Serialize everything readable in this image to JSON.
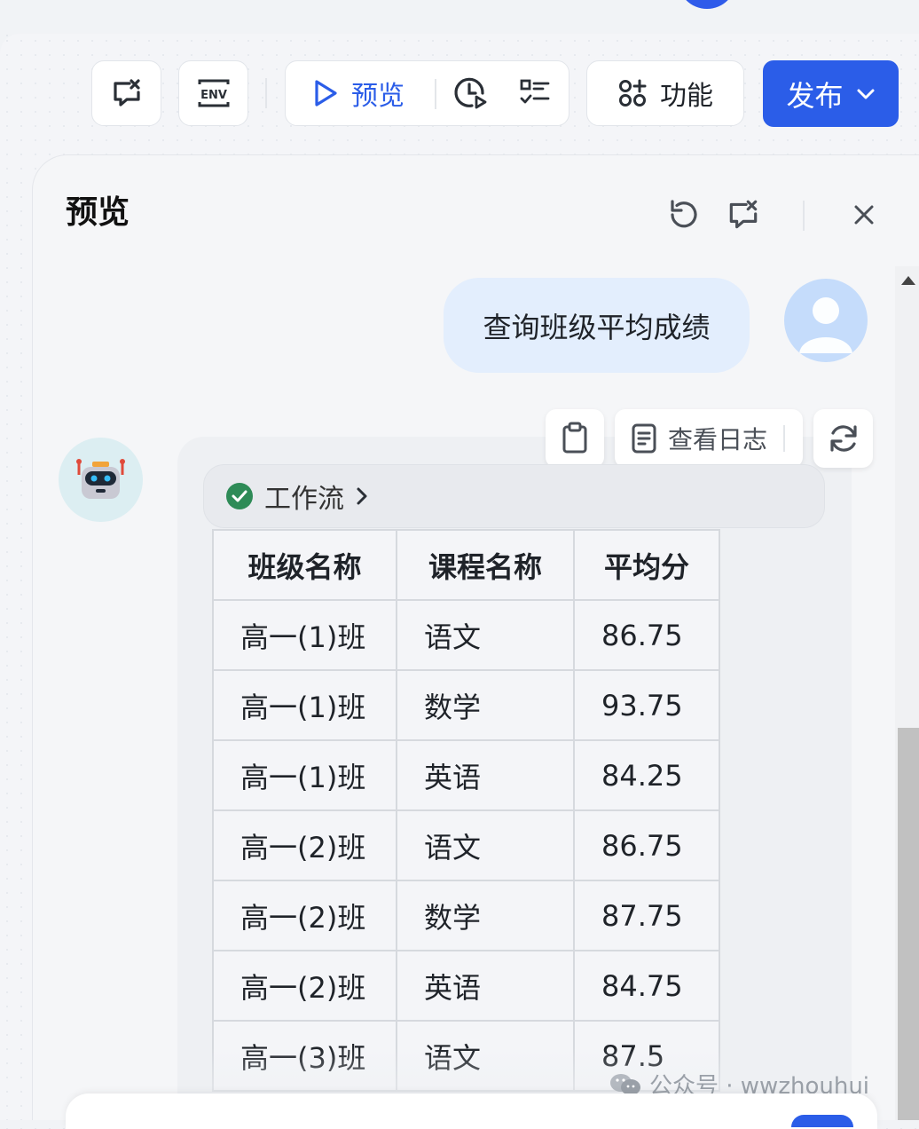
{
  "toolbar": {
    "preview_label": "预览",
    "features_label": "功能",
    "publish_label": "发布",
    "env_icon_text": "ENV"
  },
  "panel": {
    "title": "预览"
  },
  "chat": {
    "user_message": "查询班级平均成绩",
    "view_log_label": "查看日志",
    "workflow_label": "工作流"
  },
  "table": {
    "headers": [
      "班级名称",
      "课程名称",
      "平均分"
    ],
    "rows": [
      [
        "高一(1)班",
        "语文",
        "86.75"
      ],
      [
        "高一(1)班",
        "数学",
        "93.75"
      ],
      [
        "高一(1)班",
        "英语",
        "84.25"
      ],
      [
        "高一(2)班",
        "语文",
        "86.75"
      ],
      [
        "高一(2)班",
        "数学",
        "87.75"
      ],
      [
        "高一(2)班",
        "英语",
        "84.75"
      ],
      [
        "高一(3)班",
        "语文",
        "87.5"
      ]
    ]
  },
  "watermark": "公众号 · wwzhouhui",
  "colors": {
    "accent": "#2b5de8",
    "user_bubble": "#e3eefd",
    "success": "#2e8b57"
  },
  "icons": [
    "debug-chat-icon",
    "env-icon",
    "play-icon",
    "history-icon",
    "checklist-icon",
    "features-icon",
    "chevron-down-icon",
    "refresh-icon",
    "close-icon",
    "user-avatar-icon",
    "clipboard-icon",
    "log-icon",
    "regenerate-icon",
    "robot-avatar-icon",
    "check-circle-icon",
    "chevron-right-icon"
  ]
}
